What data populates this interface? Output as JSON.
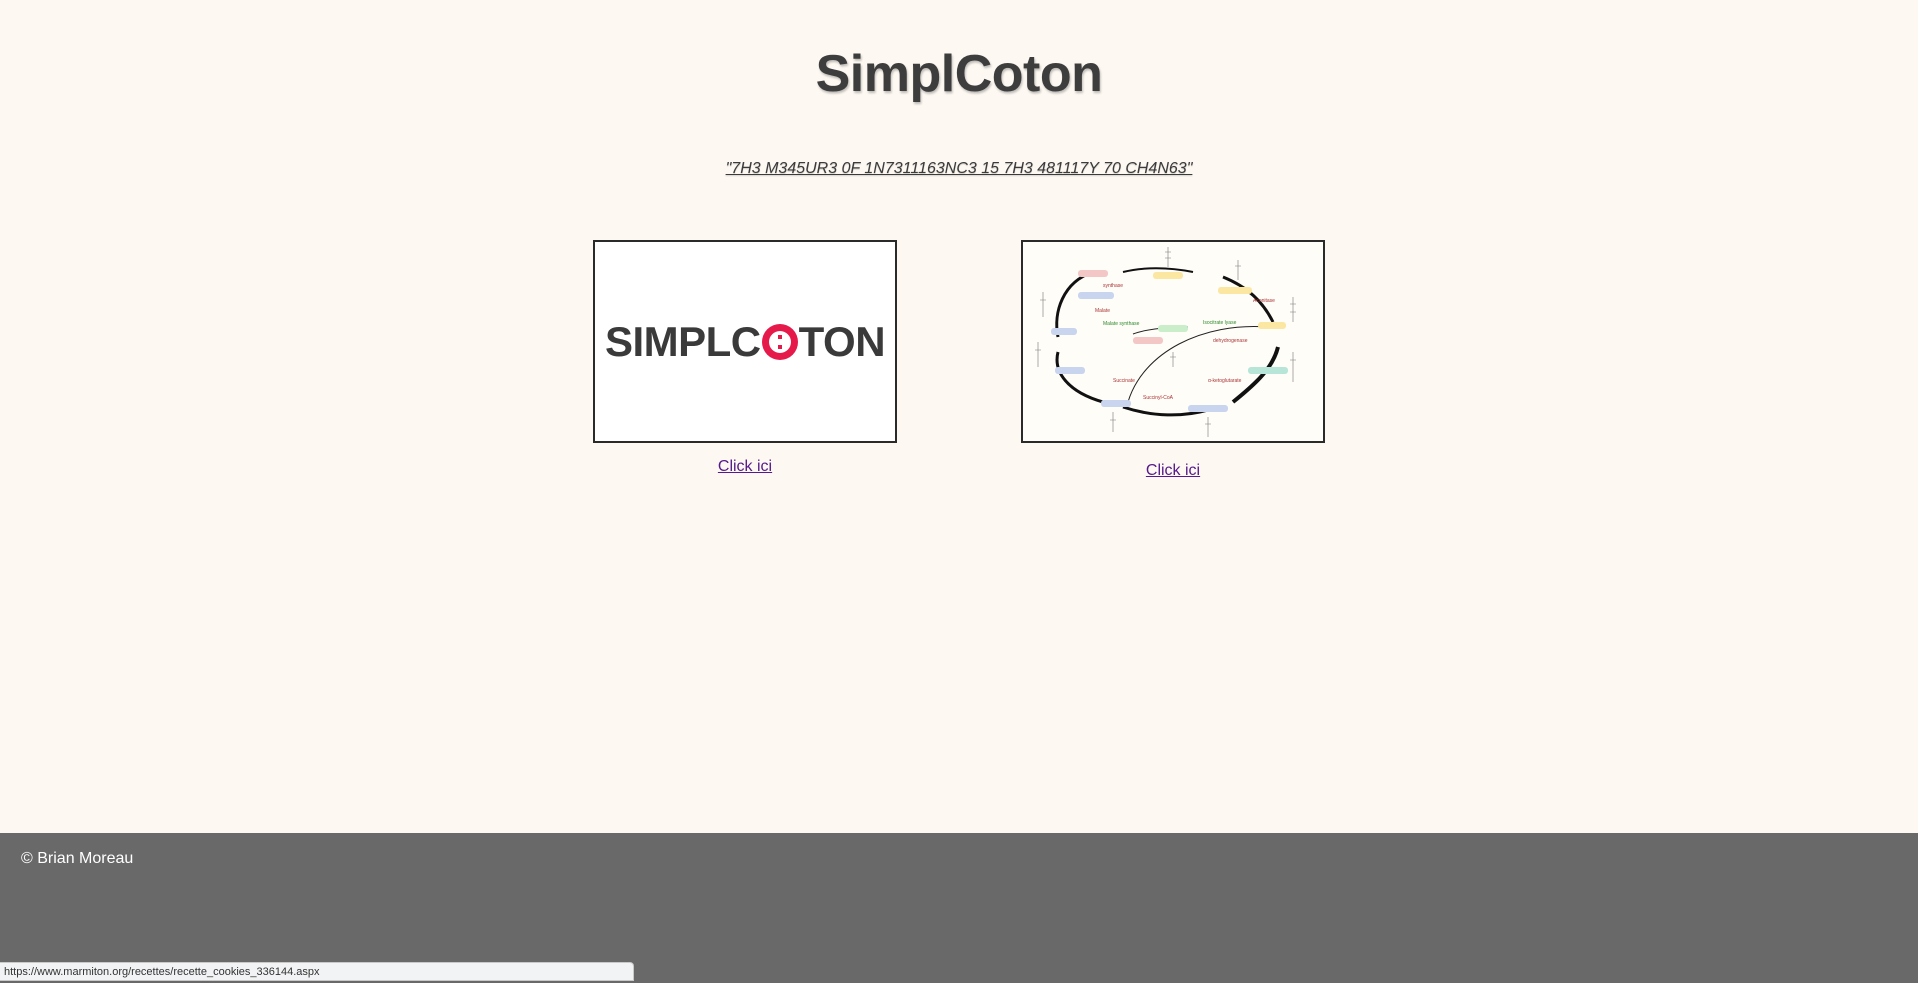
{
  "header": {
    "title": "SimplCoton",
    "tagline": "\"7H3 M345UR3 0F 1N7311163NC3 15 7H3 481117Y 70 CH4N63\""
  },
  "cards": [
    {
      "logo_text_before": "SIMPLC",
      "logo_text_after": "TON",
      "link_label": "Click ici"
    },
    {
      "link_label": "Click ici",
      "diagram_labels": [
        "Citrate",
        "Succinate",
        "Malate",
        "Fumarate"
      ]
    }
  ],
  "footer": {
    "copyright": "© Brian Moreau"
  },
  "status_bar": {
    "url": "https://www.marmiton.org/recettes/recette_cookies_336144.aspx"
  },
  "colors": {
    "background": "#fdf8f2",
    "footer": "#696969",
    "logo_accent": "#e6194b",
    "visited_link": "#551a8b"
  }
}
